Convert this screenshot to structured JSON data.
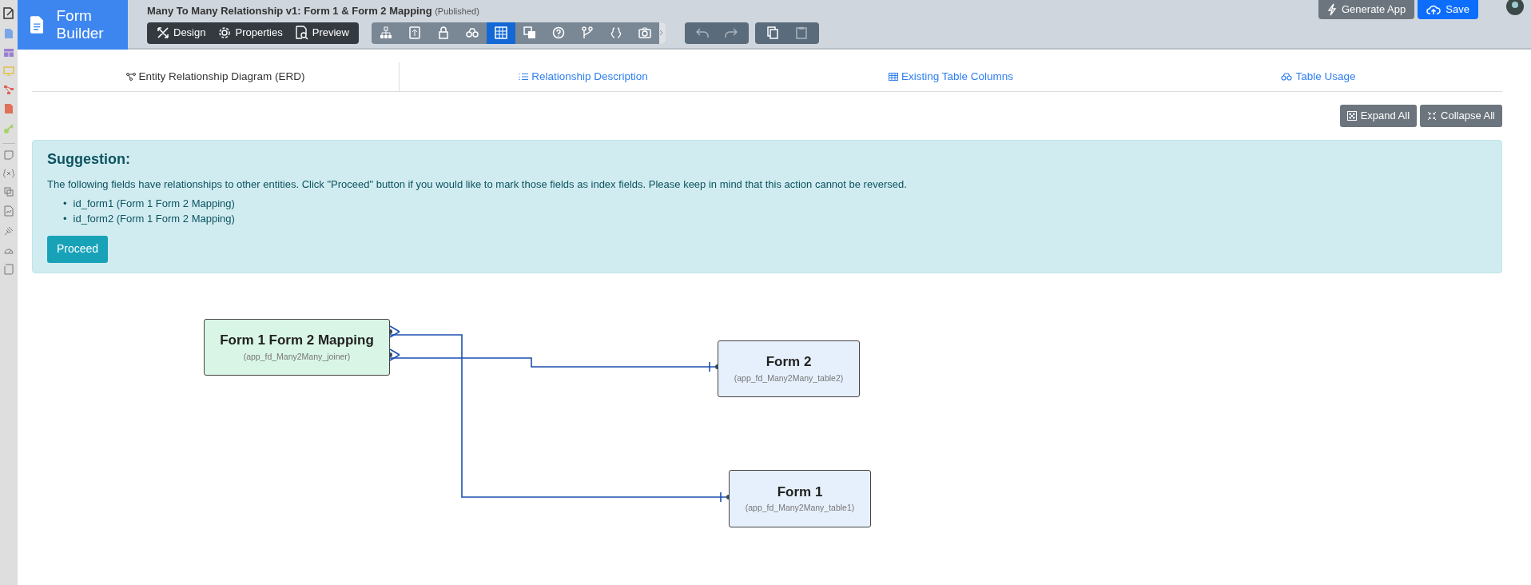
{
  "app": {
    "name": "Form Builder"
  },
  "header": {
    "title": "Many To Many Relationship v1: Form 1 & Form 2 Mapping",
    "status": "(Published)"
  },
  "mode_buttons": [
    {
      "label": "Design"
    },
    {
      "label": "Properties"
    },
    {
      "label": "Preview"
    }
  ],
  "tools": [
    {
      "selected": false
    },
    {
      "selected": false
    },
    {
      "selected": false
    },
    {
      "selected": false
    },
    {
      "selected": true
    },
    {
      "selected": false
    },
    {
      "selected": false
    },
    {
      "selected": false
    },
    {
      "selected": false
    },
    {
      "selected": false
    }
  ],
  "actions": [
    {
      "label": "Generate App",
      "kind": "secondary"
    },
    {
      "label": "Save",
      "kind": "primary"
    }
  ],
  "tabs": [
    {
      "label": "Entity Relationship Diagram (ERD)",
      "selected": true
    },
    {
      "label": "Relationship Description",
      "selected": false
    },
    {
      "label": "Existing Table Columns",
      "selected": false
    },
    {
      "label": "Table Usage",
      "selected": false
    }
  ],
  "tree_buttons": [
    {
      "label": "Expand All"
    },
    {
      "label": "Collapse All"
    }
  ],
  "suggestion": {
    "title": "Suggestion:",
    "text": "The following fields have relationships to other entities. Click \"Proceed\" button if you would like to mark those fields as index fields. Please keep in mind that this action cannot be reversed.",
    "fields": [
      {
        "bullet": "•",
        "text": "id_form1 (Form 1 Form 2 Mapping)"
      },
      {
        "bullet": "•",
        "text": "id_form2 (Form 1 Form 2 Mapping)"
      }
    ],
    "button": "Proceed"
  },
  "entities": [
    {
      "name": "Form 1 Form 2 Mapping",
      "table": "(app_fd_Many2Many_joiner)",
      "color": "#d9f5e6"
    },
    {
      "name": "Form 2",
      "table": "(app_fd_Many2Many_table2)",
      "color": "#e6f0fc"
    },
    {
      "name": "Form 1",
      "table": "(app_fd_Many2Many_table1)",
      "color": "#e6f0fc"
    }
  ]
}
